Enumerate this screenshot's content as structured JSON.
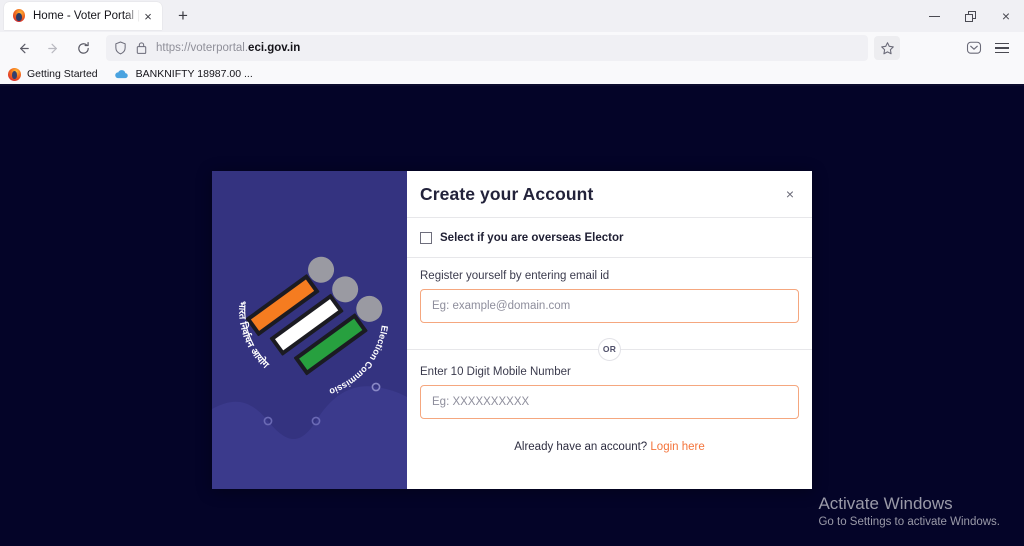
{
  "browser": {
    "tab": {
      "title": "Home - Voter Portal | Election C",
      "favicon": "firefox-icon",
      "close": "×"
    },
    "newtab_label": "+",
    "window_controls": {
      "minimize": "minimize-icon",
      "restore": "restore-icon",
      "close": "×"
    },
    "nav": {
      "back": "←",
      "forward": "→",
      "reload": "↻"
    },
    "urlbar": {
      "shield": "shield-icon",
      "lock": "lock-icon",
      "url_prefix": "https://voterportal.",
      "url_domain": "eci.gov.in",
      "bookmark": "star-icon"
    },
    "toolbar": {
      "pocket": "pocket-icon",
      "menu": "hamburger-icon"
    },
    "bookmarks": [
      {
        "label": "Getting Started",
        "icon": "firefox-icon"
      },
      {
        "label": "BANKNIFTY 18987.00 ...",
        "icon": "cloud-icon"
      }
    ]
  },
  "brand": {
    "logo_name": "election-commission-of-india-logo",
    "text_hindi": "भारत निर्वाचन आयोग",
    "text_english": "Election Commission of India",
    "panel_color": "#343380"
  },
  "modal": {
    "title": "Create your Account",
    "close_label": "×",
    "overseas_label": "Select if you are overseas Elector",
    "overseas_checked": false,
    "email": {
      "label": "Register yourself by entering email id",
      "placeholder": "Eg: example@domain.com",
      "value": ""
    },
    "divider_label": "OR",
    "mobile": {
      "label": "Enter 10 Digit Mobile Number",
      "placeholder": "Eg: XXXXXXXXXX",
      "value": ""
    },
    "footer": {
      "prompt": "Already have an account?",
      "link": "Login here"
    },
    "accent_color": "#f4743b",
    "input_border_color": "#f5a77f"
  },
  "watermark": {
    "title": "Activate Windows",
    "subtitle": "Go to Settings to activate Windows."
  },
  "page": {
    "background_color": "#040428"
  }
}
